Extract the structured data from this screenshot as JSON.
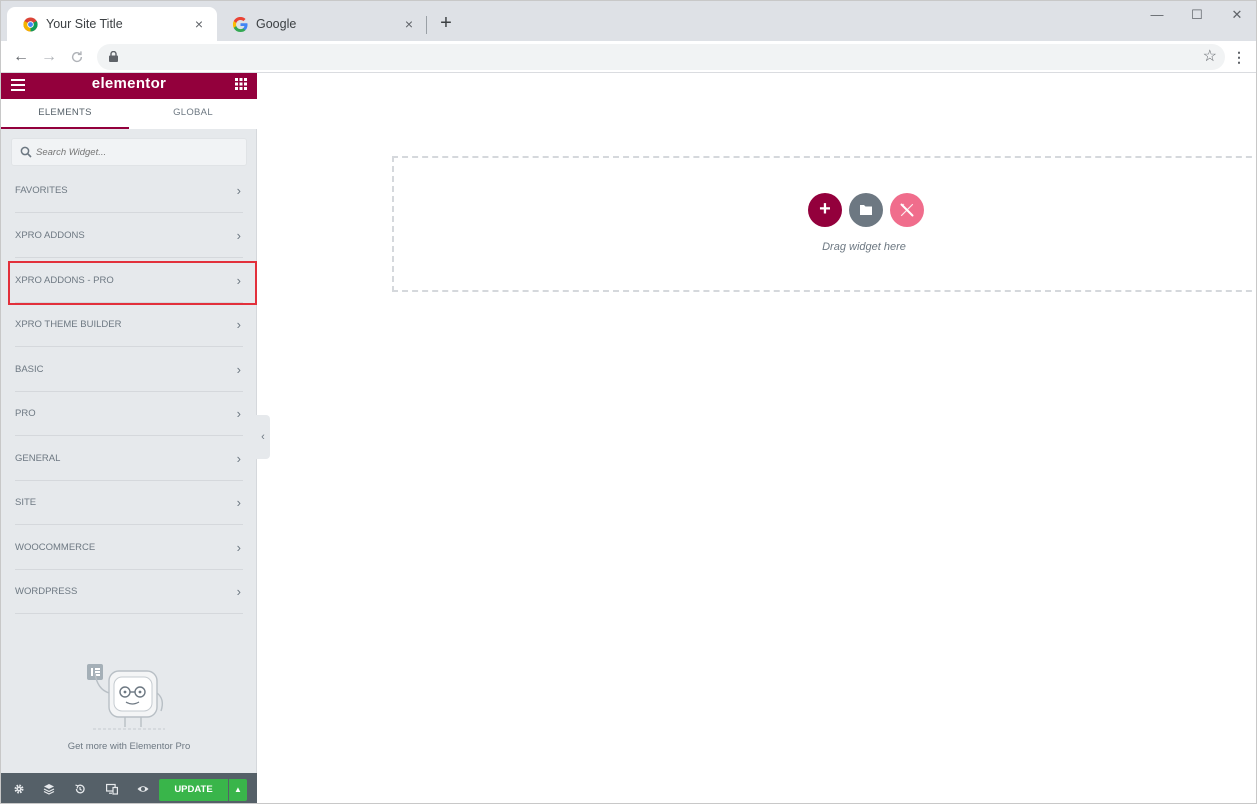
{
  "browser": {
    "tabs": [
      {
        "title": "Your Site Title",
        "close": "×"
      },
      {
        "title": "Google",
        "close": "×"
      }
    ],
    "new_tab": "+",
    "window_controls": {
      "minimize": "—",
      "maximize": "☐",
      "close": "✕"
    },
    "nav": {
      "back": "←",
      "forward": "→",
      "reload": "C"
    },
    "star": "☆",
    "menu": "⋮"
  },
  "panel": {
    "brand": "elementor",
    "tabs": [
      "ELEMENTS",
      "GLOBAL"
    ],
    "search_placeholder": "Search Widget...",
    "categories": [
      "FAVORITES",
      "XPRO ADDONS",
      "XPRO ADDONS - PRO",
      "XPRO THEME BUILDER",
      "BASIC",
      "PRO",
      "GENERAL",
      "SITE",
      "WOOCOMMERCE",
      "WORDPRESS"
    ],
    "chevron": "›",
    "promo_text": "Get more with Elementor Pro",
    "update_label": "UPDATE",
    "update_arrow": "▲",
    "collapse": "‹"
  },
  "canvas": {
    "add_icon": "+",
    "drag_text": "Drag widget here"
  },
  "colors": {
    "brand": "#93003c",
    "update": "#39b54a",
    "highlight": "#e2303b",
    "xpro": "#f06d8c"
  }
}
